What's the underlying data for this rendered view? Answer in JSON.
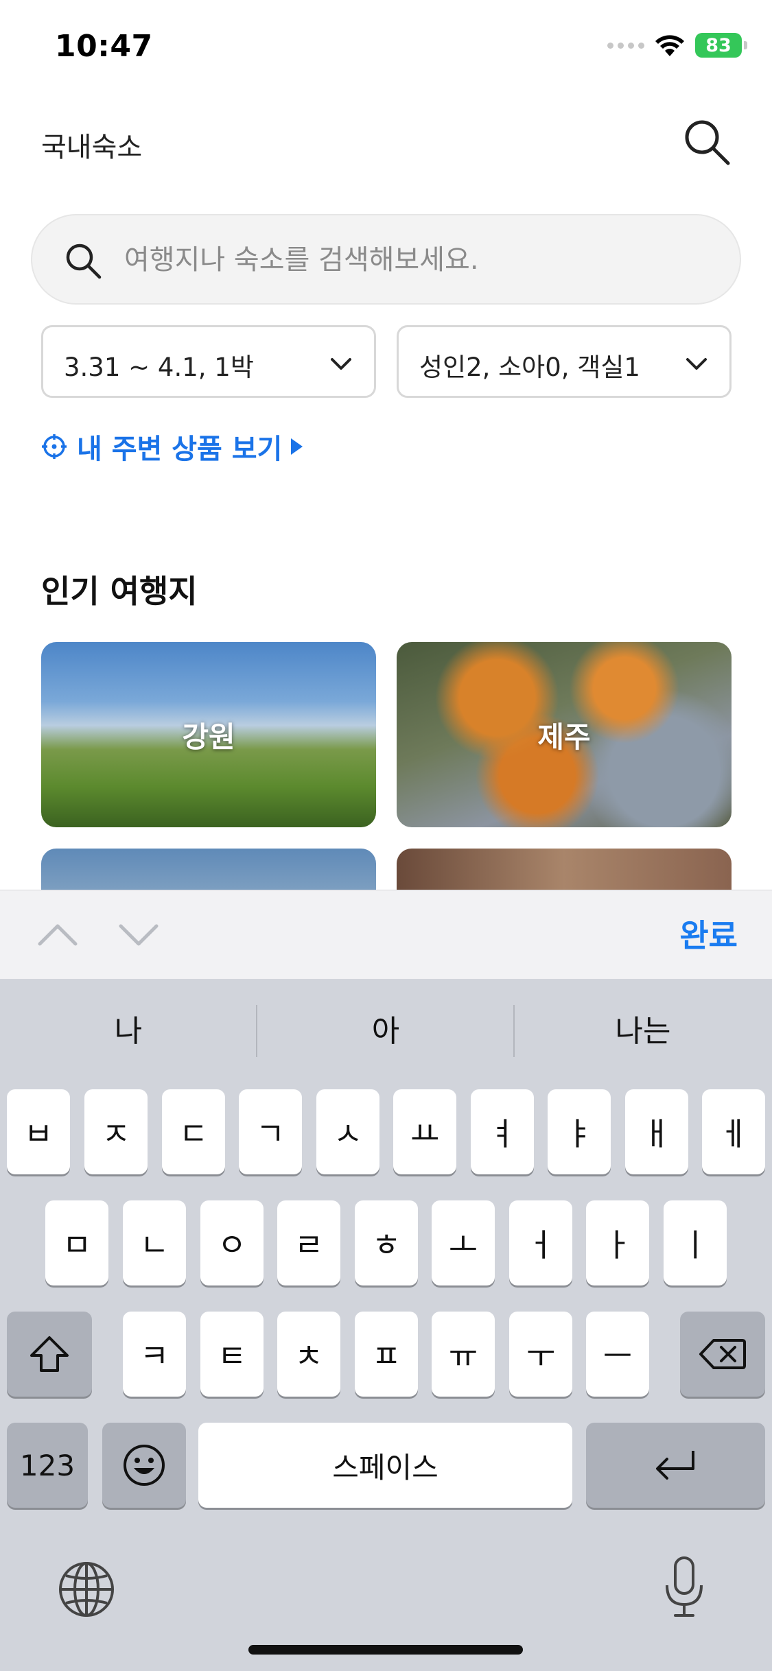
{
  "status_bar": {
    "time": "10:47",
    "battery": "83"
  },
  "header": {
    "title": "국내숙소",
    "search_icon": "search-icon"
  },
  "search": {
    "placeholder": "여행지나 숙소를 검색해보세요.",
    "value": ""
  },
  "filters": {
    "date": "3.31 ~ 4.1, 1박",
    "guests": "성인2, 소아0, 객실1"
  },
  "nearby": {
    "label": "내 주변 상품 보기"
  },
  "popular": {
    "title": "인기 여행지",
    "destinations": [
      "강원",
      "제주"
    ]
  },
  "keyboard_accessory": {
    "done_label": "완료"
  },
  "keyboard": {
    "suggestions": [
      "나",
      "아",
      "나는"
    ],
    "row1": [
      "ㅂ",
      "ㅈ",
      "ㄷ",
      "ㄱ",
      "ㅅ",
      "ㅛ",
      "ㅕ",
      "ㅑ",
      "ㅐ",
      "ㅔ"
    ],
    "row2": [
      "ㅁ",
      "ㄴ",
      "ㅇ",
      "ㄹ",
      "ㅎ",
      "ㅗ",
      "ㅓ",
      "ㅏ",
      "ㅣ"
    ],
    "row3": [
      "ㅋ",
      "ㅌ",
      "ㅊ",
      "ㅍ",
      "ㅠ",
      "ㅜ",
      "ㅡ"
    ],
    "numbers_label": "123",
    "space_label": "스페이스"
  },
  "colors": {
    "accent": "#1a73e8",
    "done": "#1a7cf0",
    "battery": "#34c759"
  }
}
